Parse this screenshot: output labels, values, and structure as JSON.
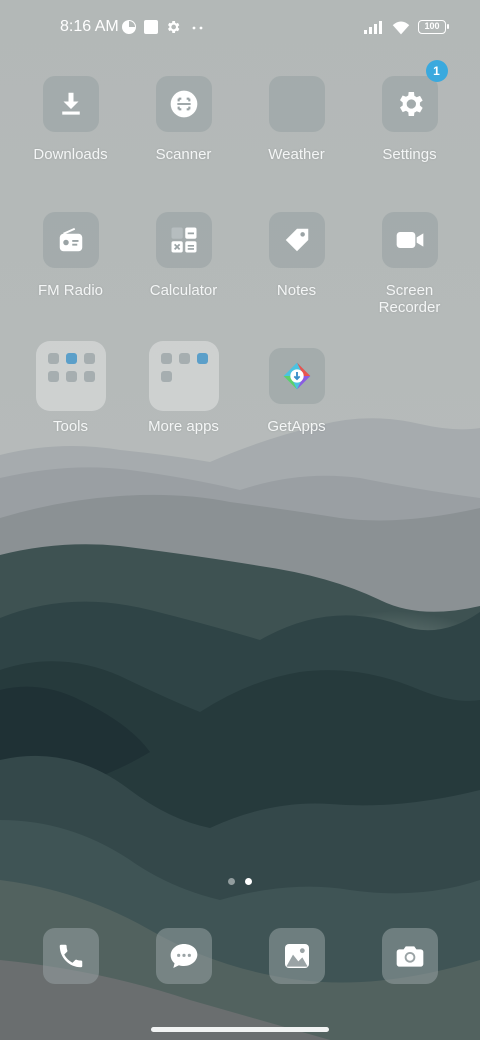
{
  "status_bar": {
    "time": "8:16 AM",
    "battery": "100",
    "left_icons": [
      "data-saver-icon",
      "square-notification-icon",
      "gear-icon",
      "more-dots-icon"
    ],
    "right_icons": [
      "signal-icon",
      "wifi-icon",
      "battery-icon"
    ]
  },
  "apps": [
    {
      "label": "Downloads",
      "icon": "download-icon"
    },
    {
      "label": "Scanner",
      "icon": "scanner-icon"
    },
    {
      "label": "Weather",
      "icon": "weather-icon"
    },
    {
      "label": "Settings",
      "icon": "gear-icon",
      "badge": "1"
    },
    {
      "label": "FM Radio",
      "icon": "radio-icon"
    },
    {
      "label": "Calculator",
      "icon": "calculator-icon"
    },
    {
      "label": "Notes",
      "icon": "tag-icon"
    },
    {
      "label": "Screen Recorder",
      "icon": "video-camera-icon"
    },
    {
      "label": "Tools",
      "icon": "folder-icon"
    },
    {
      "label": "More apps",
      "icon": "folder-icon"
    },
    {
      "label": "GetApps",
      "icon": "getapps-icon"
    }
  ],
  "dock": [
    {
      "name": "phone",
      "icon": "phone-icon"
    },
    {
      "name": "messages",
      "icon": "chat-bubble-icon"
    },
    {
      "name": "gallery",
      "icon": "gallery-icon"
    },
    {
      "name": "camera",
      "icon": "camera-icon"
    }
  ],
  "page_indicator": {
    "pages": 2,
    "current": 2
  },
  "colors": {
    "badge": "#3aa9de",
    "tile": "#96a0a2",
    "text": "#ffffff"
  }
}
